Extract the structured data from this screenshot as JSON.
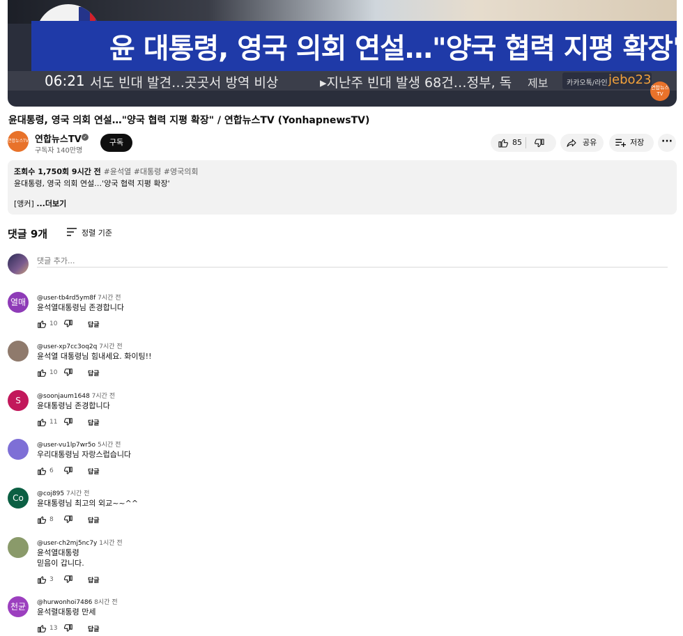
{
  "player": {
    "headline": "윤 대통령, 영국 의회 연설…\"양국 협력 지평 확장\"",
    "time": "06:21",
    "ticker_left": "서도 빈대 발견…곳곳서 방역 비상",
    "ticker_right": "▸지난주 빈대 발생 68건…정부, 독",
    "jebo_label": "제보",
    "jebo_channels": "카카오톡/라인",
    "jebo_id": "jebo23",
    "logo_text": "연합뉴스TV"
  },
  "video": {
    "title": "윤대통령, 영국 의회 연설…\"양국 협력 지평 확장\" / 연합뉴스TV (YonhapnewsTV)",
    "channel_name": "연합뉴스TV",
    "channel_avatar_text": "연합뉴스TV",
    "subscribers": "구독자 140만명",
    "subscribe_label": "구독",
    "likes": "85",
    "share_label": "공유",
    "save_label": "저장",
    "more_label": "···"
  },
  "description": {
    "stats": "조회수 1,750회  9시간 전",
    "tags": "#윤석열 #대통령 #영국의회",
    "line1": "윤대통령, 영국 의회 연설…'양국 협력 지평 확장'",
    "line2_prefix": "[앵커]",
    "more": "...더보기"
  },
  "comments_section": {
    "title": "댓글 9개",
    "sort_label": "정렬 기준",
    "add_placeholder": "댓글 추가..."
  },
  "comments": [
    {
      "author": "@user-tb4rd5ym8f",
      "time": "7시간 전",
      "text": "윤석열대통령님 존경합니다",
      "likes": "10",
      "reply": "답글",
      "avatar_text": "열매",
      "avatar_color": "#8e3bb7"
    },
    {
      "author": "@user-xp7cc3oq2q",
      "time": "7시간 전",
      "text": "윤석열 대통령님 힘내세요. 화이팅!!",
      "likes": "10",
      "reply": "답글",
      "avatar_text": "",
      "avatar_color": "#8f7a6c"
    },
    {
      "author": "@soonjaum1648",
      "time": "7시간 전",
      "text": "윤대통령님 존경합니다",
      "likes": "11",
      "reply": "답글",
      "avatar_text": "S",
      "avatar_color": "#c2185b"
    },
    {
      "author": "@user-vu1lp7wr5o",
      "time": "5시간 전",
      "text": "우리대통령님 자랑스럽습니다",
      "likes": "6",
      "reply": "답글",
      "avatar_text": "",
      "avatar_color": "#7e6fd6"
    },
    {
      "author": "@coj895",
      "time": "7시간 전",
      "text": "윤대통령님 최고의 외교~~^^",
      "likes": "8",
      "reply": "답글",
      "avatar_text": "Co",
      "avatar_color": "#0b5f43"
    },
    {
      "author": "@user-ch2mj5nc7y",
      "time": "1시간 전",
      "text": "윤석열대통령",
      "text2": "믿음이 갑니다.",
      "likes": "3",
      "reply": "답글",
      "avatar_text": "",
      "avatar_color": "#8a9a6a"
    },
    {
      "author": "@hurwonhoi7486",
      "time": "8시간 전",
      "text": "윤석렬대통령 만세",
      "likes": "13",
      "reply": "답글",
      "avatar_text": "천균",
      "avatar_color": "#9c3fbf"
    }
  ]
}
